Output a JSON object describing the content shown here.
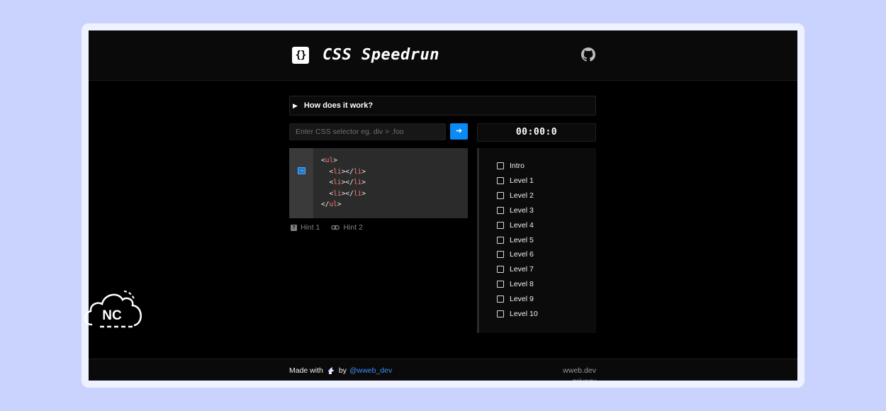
{
  "header": {
    "logo_glyph": "{}",
    "title": "CSS Speedrun",
    "github_icon": "github-icon"
  },
  "howto": {
    "label": "How does it work?"
  },
  "selector": {
    "placeholder": "Enter CSS selector eg. div > .foo",
    "value": "",
    "submit_glyph": "➔"
  },
  "timer": {
    "value": "00:00:0"
  },
  "code": {
    "lines": [
      {
        "indent": "",
        "open": "<",
        "tag": "ul",
        "close": ">",
        "end": ""
      },
      {
        "indent": "  ",
        "open": "<",
        "tag": "li",
        "close": "></",
        "tag2": "li",
        "end": ">"
      },
      {
        "indent": "  ",
        "open": "<",
        "tag": "li",
        "close": "></",
        "tag2": "li",
        "end": ">"
      },
      {
        "indent": "  ",
        "open": "<",
        "tag": "li",
        "close": "></",
        "tag2": "li",
        "end": ">"
      },
      {
        "indent": "",
        "open": "</",
        "tag": "ul",
        "close": ">",
        "end": ""
      }
    ]
  },
  "hints": [
    {
      "label": "Hint 1",
      "icon": "question-icon"
    },
    {
      "label": "Hint 2",
      "icon": "link-icon"
    }
  ],
  "levels": [
    {
      "label": "Intro",
      "checked": false
    },
    {
      "label": "Level 1",
      "checked": false
    },
    {
      "label": "Level 2",
      "checked": false
    },
    {
      "label": "Level 3",
      "checked": false
    },
    {
      "label": "Level 4",
      "checked": false
    },
    {
      "label": "Level 5",
      "checked": false
    },
    {
      "label": "Level 6",
      "checked": false
    },
    {
      "label": "Level 7",
      "checked": false
    },
    {
      "label": "Level 8",
      "checked": false
    },
    {
      "label": "Level 9",
      "checked": false
    },
    {
      "label": "Level 10",
      "checked": false
    }
  ],
  "footer": {
    "made_with": "Made with",
    "by": "by",
    "author": "@wweb_dev",
    "links": [
      "wweb.dev",
      "privacy"
    ]
  },
  "badge": {
    "text": "NC"
  },
  "colors": {
    "accent": "#0a8af5",
    "tag": "#ff7b72",
    "page_bg": "#c9d3fd"
  }
}
